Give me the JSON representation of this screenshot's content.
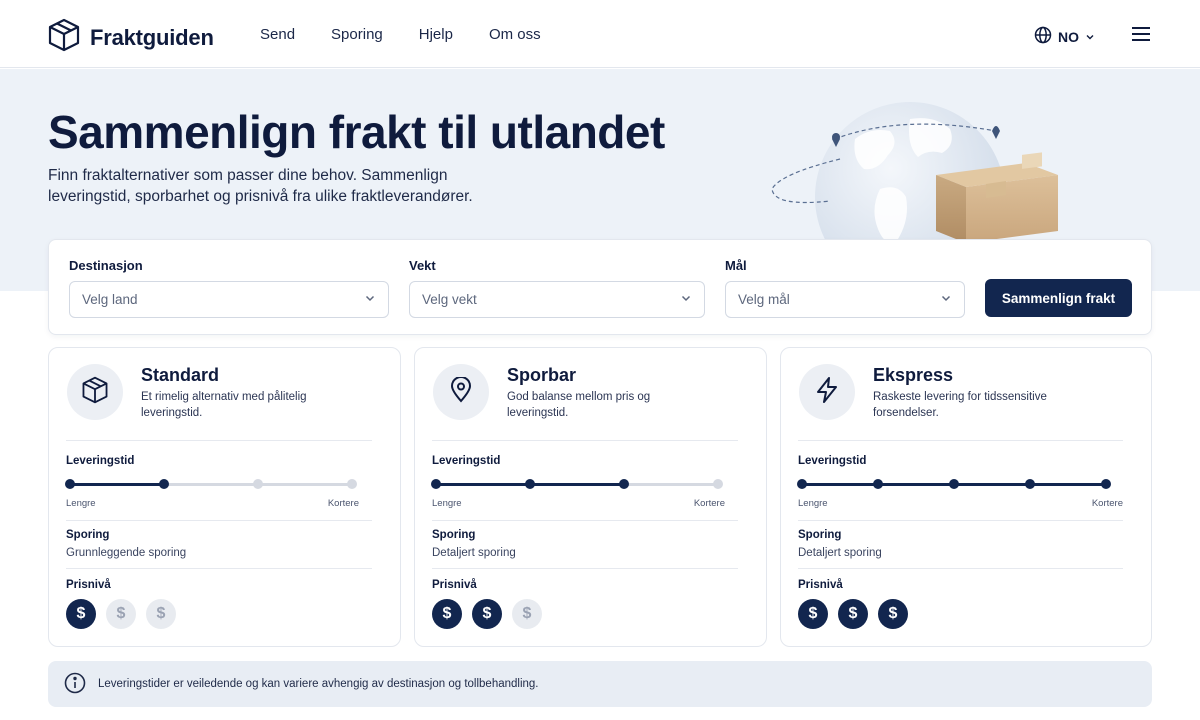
{
  "brand": {
    "name": "Fraktguiden",
    "logo_icon": "box-icon"
  },
  "nav": {
    "items": [
      "Send",
      "Sporing",
      "Hjelp",
      "Om oss"
    ]
  },
  "language": {
    "code": "NO"
  },
  "hero": {
    "title": "Sammenlign frakt til utlandet",
    "subtitle": "Finn fraktalternativer som passer dine behov. Sammenlign leveringstid, sporbarhet og prisnivå fra ulike fraktleverandører."
  },
  "search": {
    "destination": {
      "label": "Destinasjon",
      "placeholder": "Velg land"
    },
    "weight": {
      "label": "Vekt",
      "placeholder": "Velg vekt"
    },
    "dimensions": {
      "label": "Mål",
      "placeholder": "Velg mål"
    },
    "submit_label": "Sammenlign frakt"
  },
  "labels": {
    "delivery_time": "Leveringstid",
    "slower": "Lengre",
    "faster": "Kortere",
    "tracking": "Sporing",
    "price_level": "Prisnivå"
  },
  "options": [
    {
      "title": "Standard",
      "description": "Et rimelig alternativ med pålitelig leveringstid.",
      "icon": "box-icon",
      "speed_points": 4,
      "speed_level": 2,
      "tracking": "Grunnleggende sporing",
      "price_level": 1,
      "price_max": 3
    },
    {
      "title": "Sporbar",
      "description": "God balanse mellom pris og leveringstid.",
      "icon": "location-pin-icon",
      "speed_points": 4,
      "speed_level": 3,
      "tracking": "Detaljert sporing",
      "price_level": 2,
      "price_max": 3
    },
    {
      "title": "Ekspress",
      "description": "Raskeste levering for tidssensitive forsendelser.",
      "icon": "lightning-icon",
      "speed_points": 5,
      "speed_level": 5,
      "tracking": "Detaljert sporing",
      "price_level": 3,
      "price_max": 3
    }
  ],
  "price_symbol": "$",
  "info": {
    "text": "Leveringstider er veiledende og kan variere avhengig av destinasjon og tollbehandling."
  },
  "colors": {
    "primary": "#12264f",
    "hero_bg": "#edf2f8",
    "muted": "#d5d9e1"
  }
}
